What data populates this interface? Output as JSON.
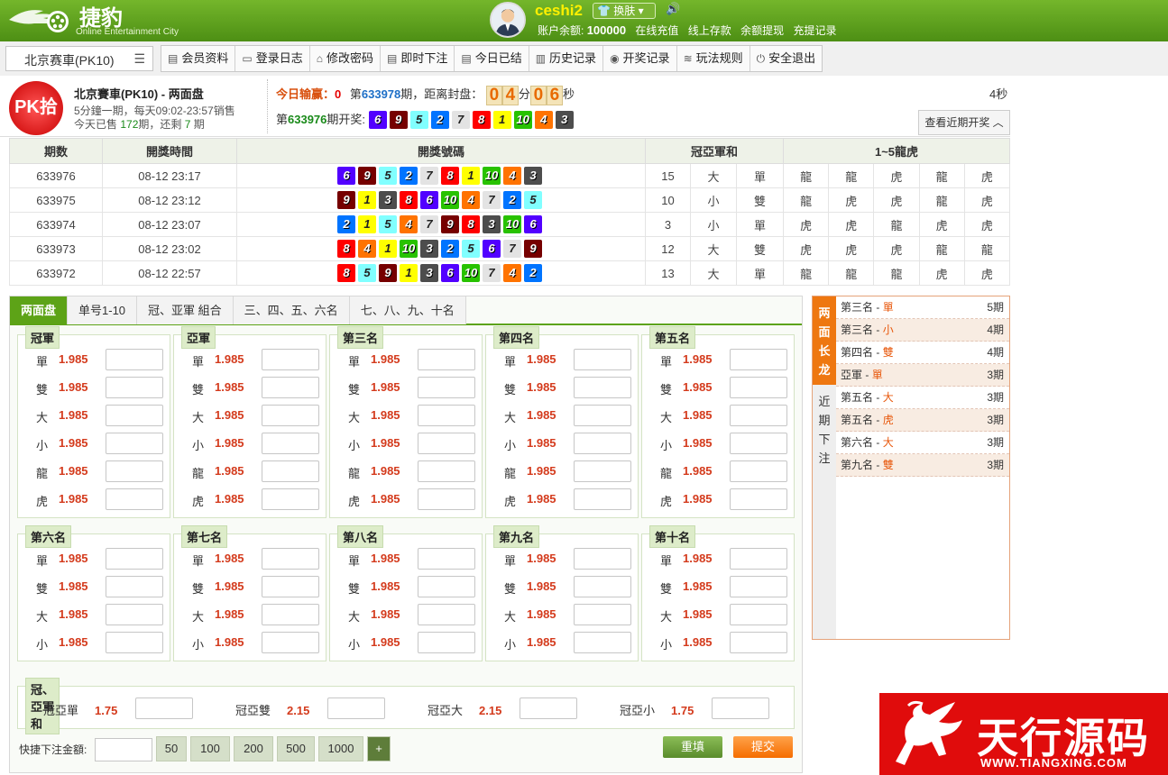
{
  "header": {
    "brand": "捷豹",
    "brand_sub": "Online Entertainment City",
    "username": "ceshi2",
    "skin_label": "换肤",
    "balance_label": "账户余额:",
    "balance": "100000",
    "links": [
      "在线充值",
      "线上存款",
      "余额提现",
      "充提记录"
    ]
  },
  "nav": {
    "game_select": "北京赛車(PK10)",
    "items": [
      {
        "label": "会员资料",
        "icon": "▤"
      },
      {
        "label": "登录日志",
        "icon": "▭"
      },
      {
        "label": "修改密码",
        "icon": "⌂"
      },
      {
        "label": "即时下注",
        "icon": "▤"
      },
      {
        "label": "今日已结",
        "icon": "▤"
      },
      {
        "label": "历史记录",
        "icon": "▥"
      },
      {
        "label": "开奖记录",
        "icon": "◉"
      },
      {
        "label": "玩法规则",
        "icon": "≋"
      },
      {
        "label": "安全退出",
        "icon": "⏻"
      }
    ]
  },
  "game": {
    "logo_text": "PK拾",
    "name": "北京賽車(PK10) - 两面盘",
    "line1": "5分鐘一期，每天09:02-23:57销售",
    "line2_prefix": "今天已售 ",
    "sold": "172",
    "line2_mid": "期，还剩 ",
    "remain": "7",
    "line2_suffix": " 期",
    "today_label": "今日输赢：",
    "today_value": "0",
    "period_prefix": "第",
    "current_period": "633978",
    "period_suffix": "期，距离封盘：",
    "cd_min": [
      "0",
      "4"
    ],
    "cd_min_unit": "分",
    "cd_sec": [
      "0",
      "6"
    ],
    "cd_sec_unit": "秒",
    "latest_period": "633976",
    "latest_label": "期开奖:",
    "latest_balls": [
      6,
      9,
      5,
      2,
      7,
      8,
      1,
      10,
      4,
      3
    ],
    "right_timer": "4秒",
    "recent_btn": "查看近期开奖"
  },
  "history": {
    "headers": [
      "期数",
      "開獎時間",
      "開獎號碼",
      "冠亞軍和",
      "1~5龍虎"
    ],
    "rows": [
      {
        "period": "633976",
        "time": "08-12 23:17",
        "balls": [
          6,
          9,
          5,
          2,
          7,
          8,
          1,
          10,
          4,
          3
        ],
        "sum": "15",
        "bs": "大",
        "oe": "單",
        "lh": [
          "龍",
          "龍",
          "虎",
          "龍",
          "虎"
        ]
      },
      {
        "period": "633975",
        "time": "08-12 23:12",
        "balls": [
          9,
          1,
          3,
          8,
          6,
          10,
          4,
          7,
          2,
          5
        ],
        "sum": "10",
        "bs": "小",
        "oe": "雙",
        "lh": [
          "龍",
          "虎",
          "虎",
          "龍",
          "虎"
        ]
      },
      {
        "period": "633974",
        "time": "08-12 23:07",
        "balls": [
          2,
          1,
          5,
          4,
          7,
          9,
          8,
          3,
          10,
          6
        ],
        "sum": "3",
        "bs": "小",
        "oe": "單",
        "lh": [
          "虎",
          "虎",
          "龍",
          "虎",
          "虎"
        ]
      },
      {
        "period": "633973",
        "time": "08-12 23:02",
        "balls": [
          8,
          4,
          1,
          10,
          3,
          2,
          5,
          6,
          7,
          9
        ],
        "sum": "12",
        "bs": "大",
        "oe": "雙",
        "lh": [
          "虎",
          "虎",
          "虎",
          "龍",
          "龍"
        ]
      },
      {
        "period": "633972",
        "time": "08-12 22:57",
        "balls": [
          8,
          5,
          9,
          1,
          3,
          6,
          10,
          7,
          4,
          2
        ],
        "sum": "13",
        "bs": "大",
        "oe": "單",
        "lh": [
          "龍",
          "龍",
          "龍",
          "虎",
          "虎"
        ]
      }
    ]
  },
  "tabs": [
    "两面盘",
    "单号1-10",
    "冠、亚軍 組合",
    "三、四、五、六名",
    "七、八、九、十名"
  ],
  "bet_cards": [
    {
      "title": "冠軍",
      "opts": [
        "單",
        "雙",
        "大",
        "小",
        "龍",
        "虎"
      ]
    },
    {
      "title": "亞軍",
      "opts": [
        "單",
        "雙",
        "大",
        "小",
        "龍",
        "虎"
      ]
    },
    {
      "title": "第三名",
      "opts": [
        "單",
        "雙",
        "大",
        "小",
        "龍",
        "虎"
      ]
    },
    {
      "title": "第四名",
      "opts": [
        "單",
        "雙",
        "大",
        "小",
        "龍",
        "虎"
      ]
    },
    {
      "title": "第五名",
      "opts": [
        "單",
        "雙",
        "大",
        "小",
        "龍",
        "虎"
      ]
    },
    {
      "title": "第六名",
      "opts": [
        "單",
        "雙",
        "大",
        "小"
      ]
    },
    {
      "title": "第七名",
      "opts": [
        "單",
        "雙",
        "大",
        "小"
      ]
    },
    {
      "title": "第八名",
      "opts": [
        "單",
        "雙",
        "大",
        "小"
      ]
    },
    {
      "title": "第九名",
      "opts": [
        "單",
        "雙",
        "大",
        "小"
      ]
    },
    {
      "title": "第十名",
      "opts": [
        "單",
        "雙",
        "大",
        "小"
      ]
    }
  ],
  "odds": "1.985",
  "sum_card": {
    "title": "冠、亞軍和",
    "items": [
      {
        "label": "冠亞單",
        "odds": "1.75"
      },
      {
        "label": "冠亞雙",
        "odds": "2.15"
      },
      {
        "label": "冠亞大",
        "odds": "2.15"
      },
      {
        "label": "冠亞小",
        "odds": "1.75"
      }
    ]
  },
  "quick": {
    "label": "快捷下注金額:",
    "amounts": [
      "50",
      "100",
      "200",
      "500",
      "1000",
      "+"
    ],
    "reset": "重填",
    "submit": "提交"
  },
  "sidebar": {
    "tab1": [
      "两",
      "面",
      "长",
      "龙"
    ],
    "tab2": [
      "近",
      "期",
      "下",
      "注"
    ],
    "items": [
      {
        "name": "第三名",
        "val": "單",
        "count": "5期"
      },
      {
        "name": "第三名",
        "val": "小",
        "count": "4期"
      },
      {
        "name": "第四名",
        "val": "雙",
        "count": "4期"
      },
      {
        "name": "亞軍",
        "val": "單",
        "count": "3期"
      },
      {
        "name": "第五名",
        "val": "大",
        "count": "3期"
      },
      {
        "name": "第五名",
        "val": "虎",
        "count": "3期"
      },
      {
        "name": "第六名",
        "val": "大",
        "count": "3期"
      },
      {
        "name": "第九名",
        "val": "雙",
        "count": "3期"
      }
    ]
  },
  "watermark": {
    "title": "天行源码",
    "url": "WWW.TIANGXING.COM"
  }
}
